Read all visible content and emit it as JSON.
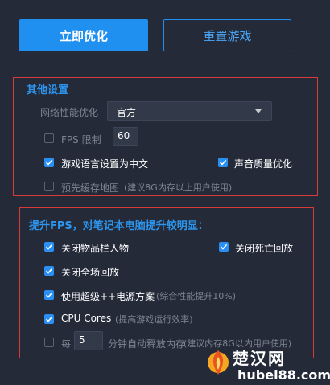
{
  "top_buttons": {
    "optimize": "立即优化",
    "reset": "重置游戏"
  },
  "other_settings": {
    "title": "其他设置",
    "network_label": "网络性能优化",
    "network_value": "官方",
    "fps_limit_label": "FPS 限制",
    "fps_limit_value": "60",
    "fps_limit_checked": false,
    "game_language_label": "游戏语言设置为中文",
    "game_language_checked": true,
    "sound_quality_label": "声音质量优化",
    "sound_quality_checked": true,
    "precache_label": "预先缓存地图",
    "precache_note": "(建议8G内存以上用户使用)",
    "precache_checked": false
  },
  "fps_boost": {
    "title": "提升FPS，对笔记本电脑提升较明显：",
    "close_item_bar": "关闭物品栏人物",
    "close_item_bar_checked": true,
    "close_death_replay": "关闭死亡回放",
    "close_death_replay_checked": true,
    "close_full_replay": "关闭全场回放",
    "close_full_replay_checked": true,
    "super_power_label": "使用超级++电源方案",
    "super_power_note": "(综合性能提升10%)",
    "super_power_checked": true,
    "cpu_cores_label": "CPU Cores",
    "cpu_cores_note": "(提高游戏运行效率)",
    "cpu_cores_checked": true,
    "release_prefix": "每",
    "release_minutes": "5",
    "release_suffix": "分钟自动释放内存",
    "release_note": "(建议内存8G以内用户使用)",
    "release_checked": false
  },
  "watermark": {
    "title": "楚汉网",
    "url": "hubel88.com"
  },
  "colors": {
    "background": "#242a38",
    "accent": "#1f8ff0",
    "section_border": "#d83a3a"
  }
}
